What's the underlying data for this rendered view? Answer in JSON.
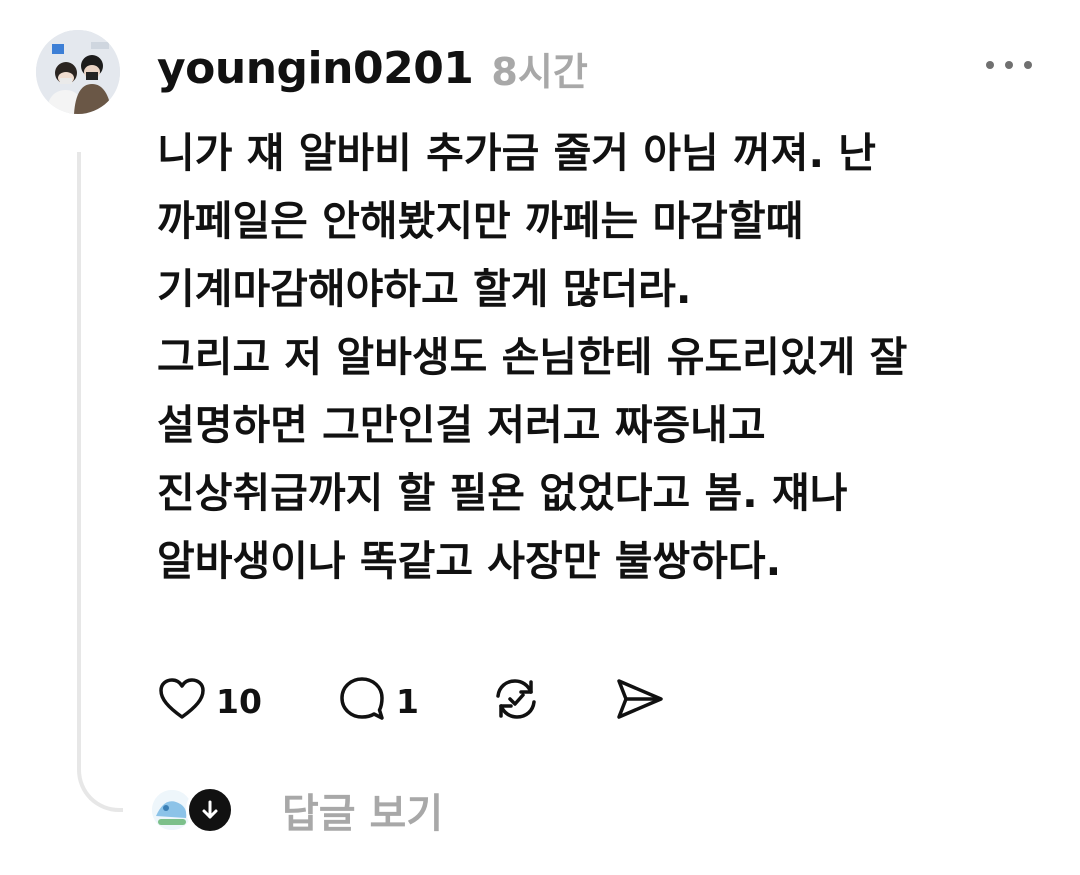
{
  "post": {
    "username": "youngin0201",
    "time": "8시간",
    "lines": [
      "니가 쟤 알바비 추가금 줄거 아님 꺼져. 난",
      "까페일은 안해봤지만 까페는 마감할때",
      "기계마감해야하고 할게 많더라.",
      "그리고 저 알바생도 손님한테 유도리있게 잘",
      "설명하면 그만인걸 저러고 짜증내고",
      "진상취급까지 할 필욘 없었다고 봄. 쟤나",
      "알바생이나 똑같고 사장만 불쌍하다."
    ]
  },
  "actions": {
    "like_count": "10",
    "comment_count": "1"
  },
  "replies": {
    "label": "답글 보기"
  },
  "icons": {
    "like": "heart-icon",
    "comment": "comment-bubble-icon",
    "repost": "repost-icon",
    "share": "send-icon",
    "more": "more-dots-icon",
    "expand": "arrow-down-icon"
  },
  "colors": {
    "text": "#111111",
    "muted": "#a8a8a8",
    "thread_line": "#e7e7e7"
  }
}
